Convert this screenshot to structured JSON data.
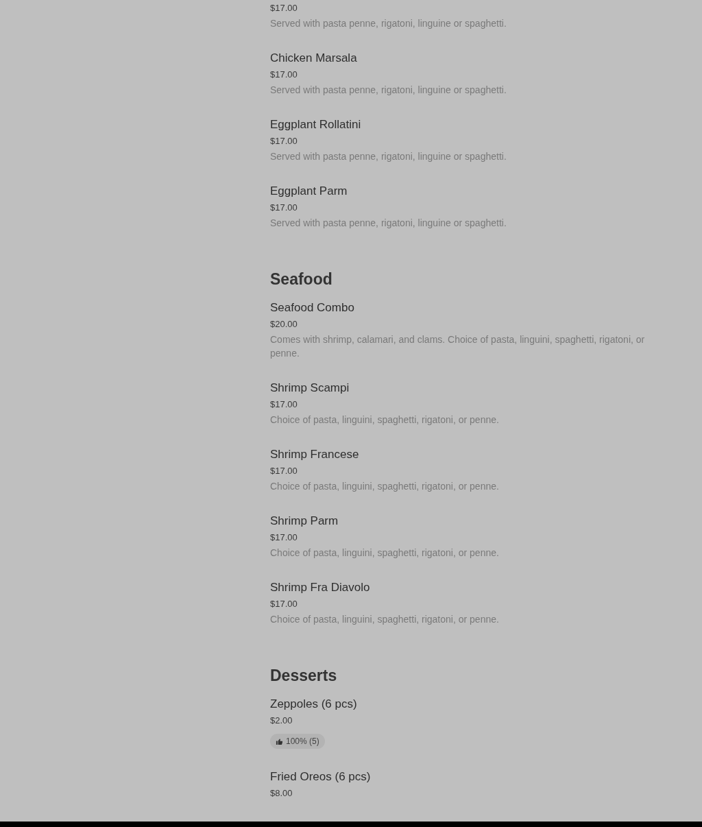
{
  "sections": [
    {
      "items": [
        {
          "price": "$17.00",
          "description": "Served with pasta penne, rigatoni, linguine or spaghetti."
        },
        {
          "name": "Chicken Marsala",
          "price": "$17.00",
          "description": "Served with pasta penne, rigatoni, linguine or spaghetti."
        },
        {
          "name": "Eggplant Rollatini",
          "price": "$17.00",
          "description": "Served with pasta penne, rigatoni, linguine or spaghetti."
        },
        {
          "name": "Eggplant Parm",
          "price": "$17.00",
          "description": "Served with pasta penne, rigatoni, linguine or spaghetti."
        }
      ]
    },
    {
      "title": "Seafood",
      "items": [
        {
          "name": "Seafood Combo",
          "price": "$20.00",
          "description": "Comes with shrimp, calamari, and clams. Choice of pasta, linguini, spaghetti, rigatoni, or penne."
        },
        {
          "name": "Shrimp Scampi",
          "price": "$17.00",
          "description": "Choice of pasta, linguini, spaghetti, rigatoni, or penne."
        },
        {
          "name": "Shrimp Francese",
          "price": "$17.00",
          "description": "Choice of pasta, linguini, spaghetti, rigatoni, or penne."
        },
        {
          "name": "Shrimp Parm",
          "price": "$17.00",
          "description": "Choice of pasta, linguini, spaghetti, rigatoni, or penne."
        },
        {
          "name": "Shrimp Fra Diavolo",
          "price": "$17.00",
          "description": "Choice of pasta, linguini, spaghetti, rigatoni, or penne."
        }
      ]
    },
    {
      "title": "Desserts",
      "items": [
        {
          "name": "Zeppoles (6 pcs)",
          "price": "$2.00",
          "rating": "100% (5)"
        },
        {
          "name": "Fried Oreos (6 pcs)",
          "price": "$8.00"
        }
      ]
    }
  ]
}
